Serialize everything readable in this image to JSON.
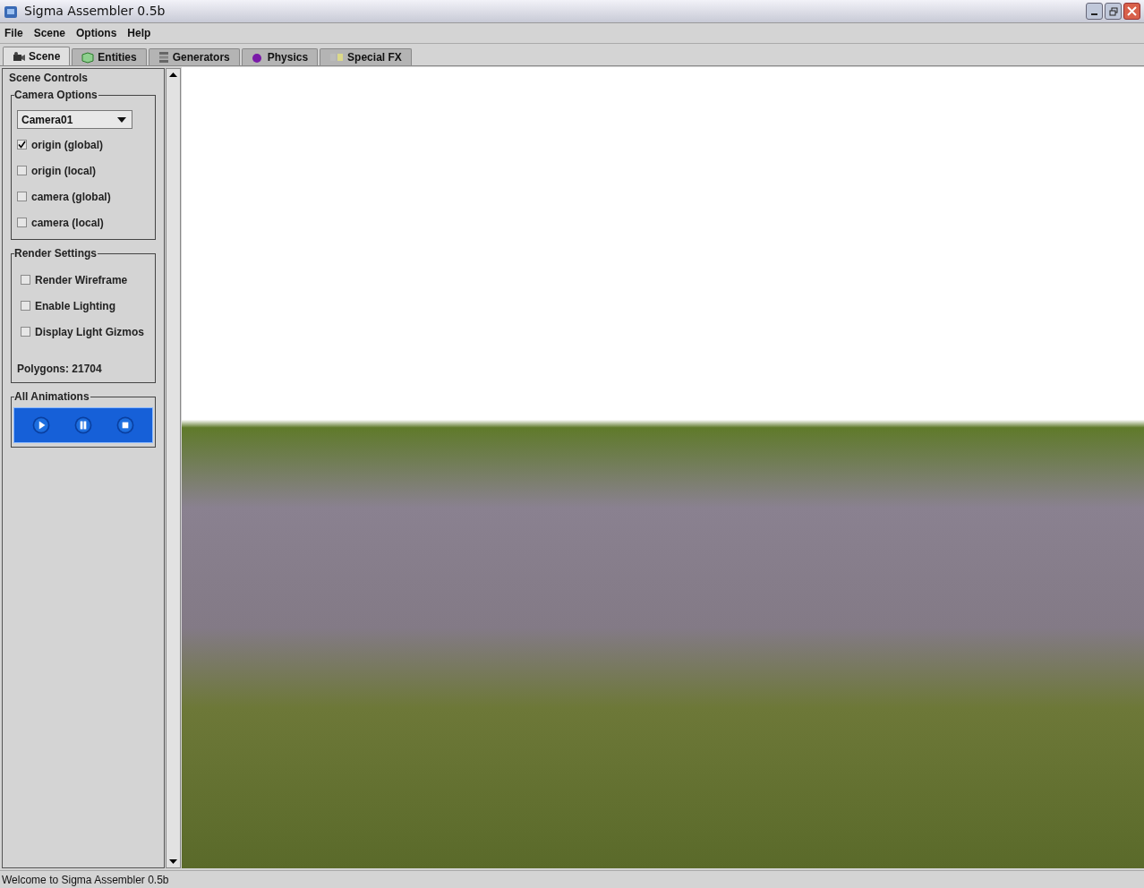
{
  "window": {
    "title": "Sigma Assembler 0.5b"
  },
  "menu": [
    "File",
    "Scene",
    "Options",
    "Help"
  ],
  "tabs": [
    {
      "label": "Scene",
      "selected": true,
      "kind": "camera"
    },
    {
      "label": "Entities",
      "selected": false,
      "kind": "cube"
    },
    {
      "label": "Generators",
      "selected": false,
      "kind": "stack"
    },
    {
      "label": "Physics",
      "selected": false,
      "kind": "sphere"
    },
    {
      "label": "Special FX",
      "selected": false,
      "kind": "fx"
    }
  ],
  "panel": {
    "title": "Scene Controls",
    "camera_options": {
      "title": "Camera Options",
      "dropdown": "Camera01",
      "checkboxes": [
        {
          "label": "origin (global)",
          "checked": true
        },
        {
          "label": "origin (local)",
          "checked": false
        },
        {
          "label": "camera (global)",
          "checked": false
        },
        {
          "label": "camera (local)",
          "checked": false
        }
      ]
    },
    "render_settings": {
      "title": "Render Settings",
      "checkboxes": [
        {
          "label": "Render Wireframe",
          "checked": false
        },
        {
          "label": "Enable Lighting",
          "checked": false
        },
        {
          "label": "Display Light Gizmos",
          "checked": false
        }
      ],
      "polygons": "Polygons: 21704"
    },
    "animations": {
      "title": "All Animations",
      "buttons": [
        {
          "kind": "play"
        },
        {
          "kind": "pause"
        },
        {
          "kind": "stop"
        }
      ]
    }
  },
  "status_bar": "Welcome to Sigma Assembler 0.5b"
}
